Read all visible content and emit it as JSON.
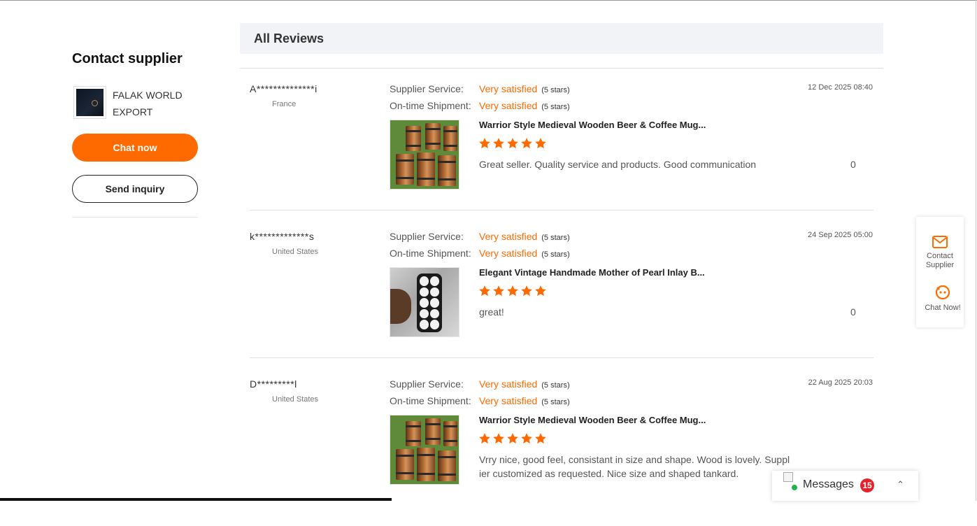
{
  "contact": {
    "title": "Contact supplier",
    "supplier_name": "FALAK WORLD EXPORT",
    "chat_label": "Chat now",
    "inquiry_label": "Send inquiry"
  },
  "reviews": {
    "header": "All Reviews",
    "items": [
      {
        "reviewer": "A**************i",
        "country": "France",
        "service_label": "Supplier Service:",
        "service_value": "Very satisfied",
        "service_stars": "(5 stars)",
        "shipment_label": "On-time Shipment:",
        "shipment_value": "Very satisfied",
        "shipment_stars": "(5 stars)",
        "date": "12 Dec 2025 08:40",
        "product_title": "Warrior Style Medieval Wooden Beer & Coffee Mug...",
        "rating": 5,
        "comment": "Great seller. Quality service and products. Good communication",
        "likes": "0"
      },
      {
        "reviewer": "k*************s",
        "country": "United States",
        "service_label": "Supplier Service:",
        "service_value": "Very satisfied",
        "service_stars": "(5 stars)",
        "shipment_label": "On-time Shipment:",
        "shipment_value": "Very satisfied",
        "shipment_stars": "(5 stars)",
        "date": "24 Sep 2025 05:00",
        "product_title": "Elegant Vintage Handmade Mother of Pearl Inlay B...",
        "rating": 5,
        "comment": "great!",
        "likes": "0"
      },
      {
        "reviewer": "D*********l",
        "country": "United States",
        "service_label": "Supplier Service:",
        "service_value": "Very satisfied",
        "service_stars": "(5 stars)",
        "shipment_label": "On-time Shipment:",
        "shipment_value": "Very satisfied",
        "shipment_stars": "(5 stars)",
        "date": "22 Aug 2025 20:03",
        "product_title": "Warrior Style Medieval Wooden Beer & Coffee Mug...",
        "rating": 5,
        "comment": "Vrry nice, good feel, consistant in size and shape. Wood is lovely. Supplier customized as requested. Nice size and shaped tankard.",
        "likes": ""
      }
    ]
  },
  "float_widget": {
    "contact_label": "Contact Supplier",
    "chat_label": "Chat Now!"
  },
  "messages": {
    "label": "Messages",
    "count": "15"
  },
  "colors": {
    "accent": "#ff6a00",
    "badge": "#e4222b",
    "online": "#22b14c"
  }
}
